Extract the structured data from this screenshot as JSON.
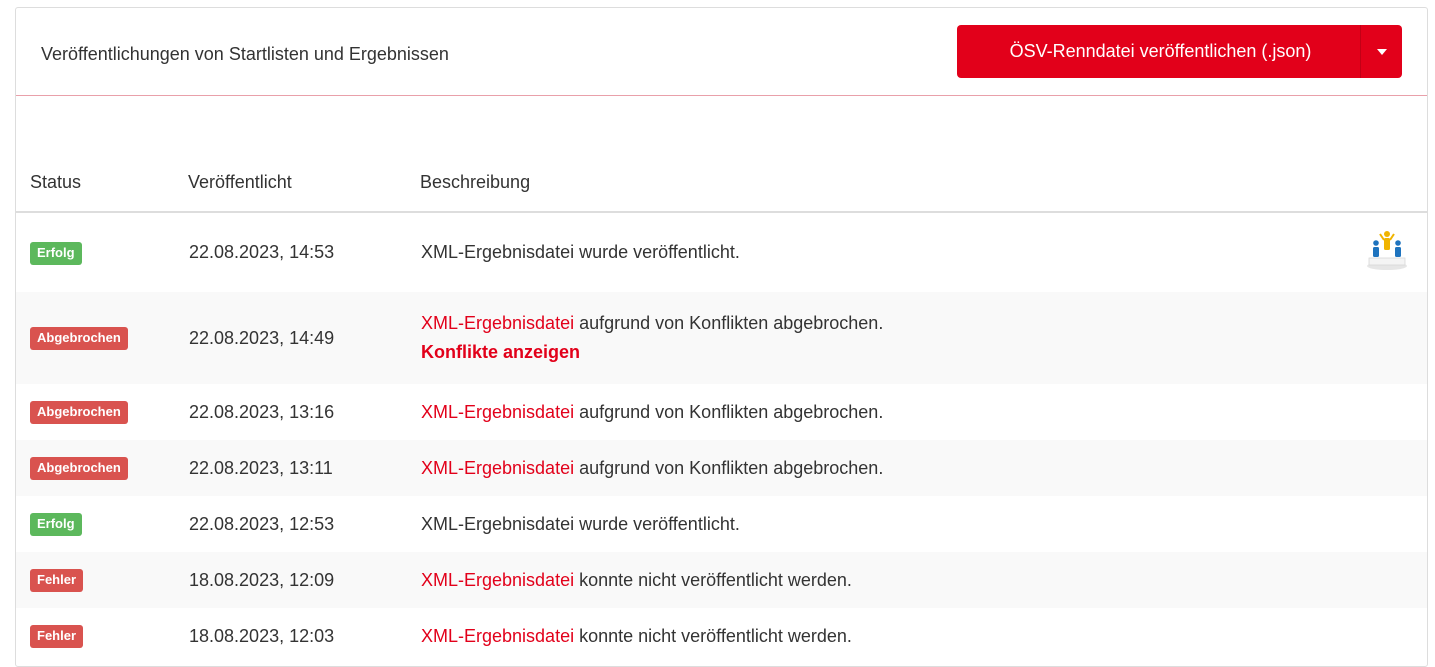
{
  "header": {
    "title": "Veröffentlichungen von Startlisten und Ergebnissen",
    "publish_button": "ÖSV-Renndatei veröffentlichen (.json)",
    "dropdown_icon": "caret-down-icon"
  },
  "table": {
    "columns": [
      "Status",
      "Veröffentlicht",
      "Beschreibung"
    ],
    "rows": [
      {
        "status": "Erfolg",
        "status_type": "success",
        "date": "22.08.2023, 14:53",
        "desc_link": "",
        "desc_text": "XML-Ergebnisdatei wurde veröffentlicht.",
        "extra_link": "",
        "icon": "podium-icon"
      },
      {
        "status": "Abgebrochen",
        "status_type": "danger",
        "date": "22.08.2023, 14:49",
        "desc_link": "XML-Ergebnisdatei",
        "desc_text": " aufgrund von Konflikten abgebrochen.",
        "extra_link": "Konflikte anzeigen",
        "icon": ""
      },
      {
        "status": "Abgebrochen",
        "status_type": "danger",
        "date": "22.08.2023, 13:16",
        "desc_link": "XML-Ergebnisdatei",
        "desc_text": " aufgrund von Konflikten abgebrochen.",
        "extra_link": "",
        "icon": ""
      },
      {
        "status": "Abgebrochen",
        "status_type": "danger",
        "date": "22.08.2023, 13:11",
        "desc_link": "XML-Ergebnisdatei",
        "desc_text": " aufgrund von Konflikten abgebrochen.",
        "extra_link": "",
        "icon": ""
      },
      {
        "status": "Erfolg",
        "status_type": "success",
        "date": "22.08.2023, 12:53",
        "desc_link": "",
        "desc_text": "XML-Ergebnisdatei wurde veröffentlicht.",
        "extra_link": "",
        "icon": ""
      },
      {
        "status": "Fehler",
        "status_type": "danger",
        "date": "18.08.2023, 12:09",
        "desc_link": "XML-Ergebnisdatei",
        "desc_text": " konnte nicht veröffentlicht werden.",
        "extra_link": "",
        "icon": ""
      },
      {
        "status": "Fehler",
        "status_type": "danger",
        "date": "18.08.2023, 12:03",
        "desc_link": "XML-Ergebnisdatei",
        "desc_text": " konnte nicht veröffentlicht werden.",
        "extra_link": "",
        "icon": ""
      }
    ]
  },
  "colors": {
    "brand_red": "#e2001a",
    "success": "#5cb85c",
    "danger": "#d9534f"
  }
}
